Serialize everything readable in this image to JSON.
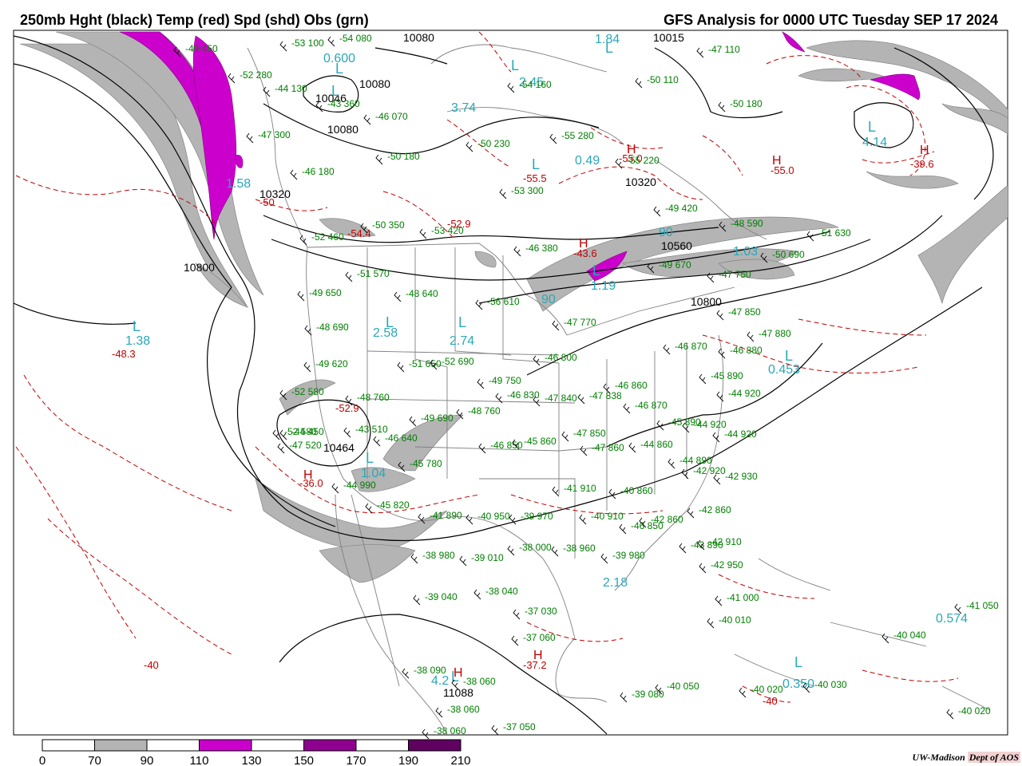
{
  "header": {
    "title_left": "250mb Hght (black) Temp (red) Spd (shd) Obs (grn)",
    "title_right": "GFS Analysis for 0000 UTC Tuesday  SEP 17 2024"
  },
  "colors": {
    "height": "#000000",
    "temperature": "#c00000",
    "observations": "#008000",
    "jet_label": "#2aa8b8",
    "borders": "#808080",
    "speed_70_90": "#b4b4b4",
    "speed_110_130": "#cc00cc",
    "speed_130_150": "#9a009a",
    "speed_150_170": "#800080",
    "speed_190_210": "#500050"
  },
  "legend": {
    "values": [
      "0",
      "70",
      "90",
      "110",
      "130",
      "150",
      "170",
      "190",
      "210"
    ],
    "bins": [
      {
        "range": "0-70",
        "color": "#ffffff"
      },
      {
        "range": "70-90",
        "color": "#b4b4b4"
      },
      {
        "range": "90-110",
        "color": "#ffffff"
      },
      {
        "range": "110-130",
        "color": "#cc00cc"
      },
      {
        "range": "130-150",
        "color": "#ffffff"
      },
      {
        "range": "150-170",
        "color": "#900090"
      },
      {
        "range": "170-190",
        "color": "#ffffff"
      },
      {
        "range": "190-210",
        "color": "#600060"
      }
    ]
  },
  "credit": {
    "org": "UW-Madison",
    "dept": "Dept of AOS"
  },
  "height_labels": [
    "10080",
    "10080",
    "10046",
    "10080",
    "10015",
    "10320",
    "10320",
    "10560",
    "10800",
    "10800",
    "10464",
    "11088"
  ],
  "temp_labels": [
    "-48.3",
    "-54.4",
    "-52.9",
    "-55.5",
    "-55.0",
    "-43.6",
    "-55.0",
    "-39.6",
    "-37.2",
    "-40",
    "-50",
    "-52.9",
    "-40",
    "-36.0"
  ],
  "jet_labels": [
    "0.600",
    "1.84",
    "2.45",
    "3.74",
    "0.49",
    "4.14",
    "1.38",
    "1.58",
    "2.58",
    "2.74",
    "1.19",
    "0.453",
    "1.04",
    "0.574",
    "0.350",
    "4.2",
    "90",
    "90",
    "1.03",
    "2.18"
  ],
  "extrema_labels": [
    {
      "letter": "L",
      "kind": "low"
    },
    {
      "letter": "H",
      "kind": "high"
    }
  ],
  "stations": [
    "-53 100",
    "-54 080",
    "-49 450",
    "-52 280",
    "-44 130",
    "-43 360",
    "-47 300",
    "-46 070",
    "-50 180",
    "-46 180",
    "-50 230",
    "-55 280",
    "-54 160",
    "-50 110",
    "-50 180",
    "-53 300",
    "-55 220",
    "-49 420",
    "-47 110",
    "-48 590",
    "-51 630",
    "-52 460",
    "-50 350",
    "-53 420",
    "-46 380",
    "-49 670",
    "-50 690",
    "-47 750",
    "-51 570",
    "-48 640",
    "-56 610",
    "-49 650",
    "-48 690",
    "-47 770",
    "-47 850",
    "-46 870",
    "-46 880",
    "-47 880",
    "-49 620",
    "-51 650",
    "-52 690",
    "-49 750",
    "-46 800",
    "-45 890",
    "-44 920",
    "-52 580",
    "-48 760",
    "-46 830",
    "-47 840",
    "-47 838",
    "-46 860",
    "-46 870",
    "-52 580",
    "-49 690",
    "-48 760",
    "-45 890",
    "-44 920",
    "-43 510",
    "-44 450",
    "-47 520",
    "-46 640",
    "-46 850",
    "-47 850",
    "-44 860",
    "-44 890",
    "-42 930",
    "-45 780",
    "-45 860",
    "-47 860",
    "-42 920",
    "-44 990",
    "-44 920",
    "-41 910",
    "-40 860",
    "-42 860",
    "-45 820",
    "-41 890",
    "-40 950",
    "-39 970",
    "-40 910",
    "-46 850",
    "-42 860",
    "-43 890",
    "-38 980",
    "-39 010",
    "-38 000",
    "-38 960",
    "-39 980",
    "-42 910",
    "-42 950",
    "-39 040",
    "-38 040",
    "-37 030",
    "-40 010",
    "-41 000",
    "-37 060",
    "-38 090",
    "-38 060",
    "-38 060",
    "-39 080",
    "-40 050",
    "-40 020",
    "-40 030",
    "-40 040",
    "-41 050",
    "-40 020",
    "-38 060",
    "-37 050"
  ]
}
